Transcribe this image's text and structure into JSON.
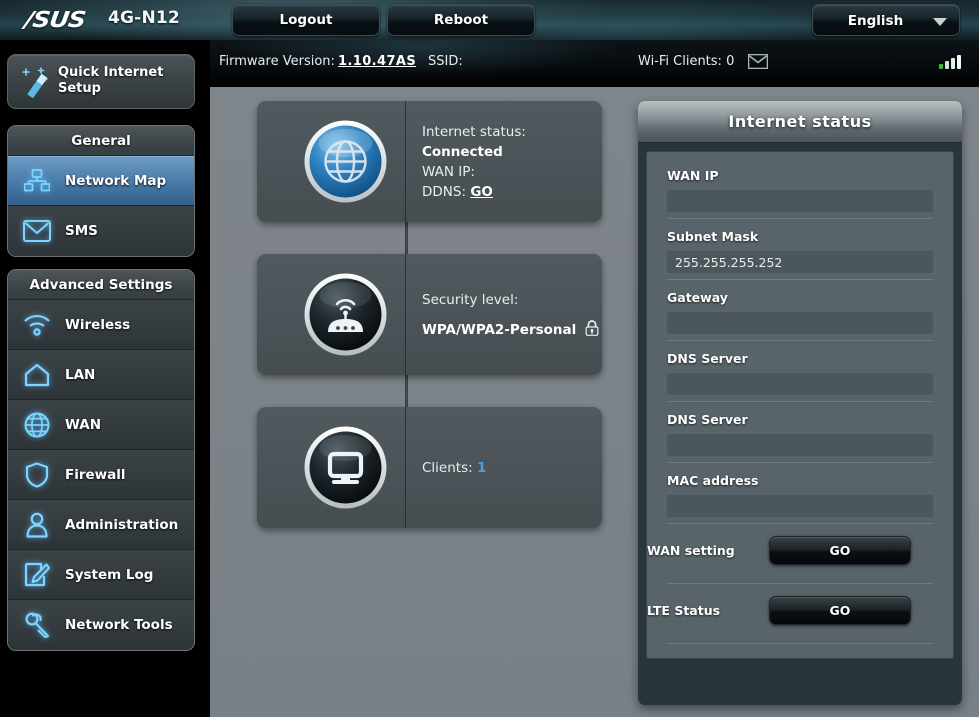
{
  "header": {
    "brand": "/SUS",
    "model": "4G-N12",
    "logout_label": "Logout",
    "reboot_label": "Reboot",
    "language": "English",
    "language_caret_icon": "chevron-down-icon"
  },
  "infobar": {
    "firmware_label": "Firmware Version:",
    "firmware_value": "1.10.47AS",
    "ssid_label": "SSID:",
    "ssid_value": "",
    "wifi_clients": "Wi-Fi Clients: 0",
    "mail_icon": "envelope-icon",
    "signal_icon": "signal-bars-icon"
  },
  "sidebar": {
    "quick_setup_label": "Quick Internet Setup",
    "quick_setup_icon": "magic-wand-icon",
    "groups": [
      {
        "title": "General",
        "items": [
          {
            "label": "Network Map",
            "icon": "network-map-icon",
            "active": true
          },
          {
            "label": "SMS",
            "icon": "sms-envelope-icon",
            "active": false
          }
        ]
      },
      {
        "title": "Advanced Settings",
        "items": [
          {
            "label": "Wireless",
            "icon": "wifi-icon",
            "active": false
          },
          {
            "label": "LAN",
            "icon": "home-icon",
            "active": false
          },
          {
            "label": "WAN",
            "icon": "globe-icon",
            "active": false
          },
          {
            "label": "Firewall",
            "icon": "shield-icon",
            "active": false
          },
          {
            "label": "Administration",
            "icon": "user-icon",
            "active": false
          },
          {
            "label": "System Log",
            "icon": "pencil-note-icon",
            "active": false
          },
          {
            "label": "Network Tools",
            "icon": "wrench-icon",
            "active": false
          }
        ]
      }
    ]
  },
  "network_map": {
    "internet_node": {
      "icon": "globe-blue-icon",
      "status_label": "Internet status:",
      "status_value": "Connected",
      "wan_ip_label": "WAN IP:",
      "wan_ip_value": "",
      "ddns_label": "DDNS:",
      "ddns_link": "GO"
    },
    "router_node": {
      "icon": "router-icon",
      "security_label": "Security level:",
      "security_value": "WPA/WPA2-Personal",
      "lock_icon": "lock-icon"
    },
    "clients_node": {
      "icon": "monitor-icon",
      "clients_label": "Clients:",
      "clients_count": "1"
    }
  },
  "status_panel": {
    "title": "Internet status",
    "fields": [
      {
        "label": "WAN IP",
        "value": ""
      },
      {
        "label": "Subnet Mask",
        "value": "255.255.255.252"
      },
      {
        "label": "Gateway",
        "value": ""
      },
      {
        "label": "DNS Server",
        "value": ""
      },
      {
        "label": "DNS Server",
        "value": ""
      },
      {
        "label": "MAC address",
        "value": ""
      }
    ],
    "actions": [
      {
        "label": "WAN setting",
        "button": "GO"
      },
      {
        "label": "LTE Status",
        "button": "GO"
      }
    ]
  },
  "colors": {
    "accent_blue": "#4a9fe0",
    "icon_glow": "#5abeff",
    "main_bg": "#7c8389",
    "card_bg": "#4b5358",
    "panel_bg": "#28353a",
    "panel_body": "#59646a",
    "signal_green": "#35c03a"
  }
}
